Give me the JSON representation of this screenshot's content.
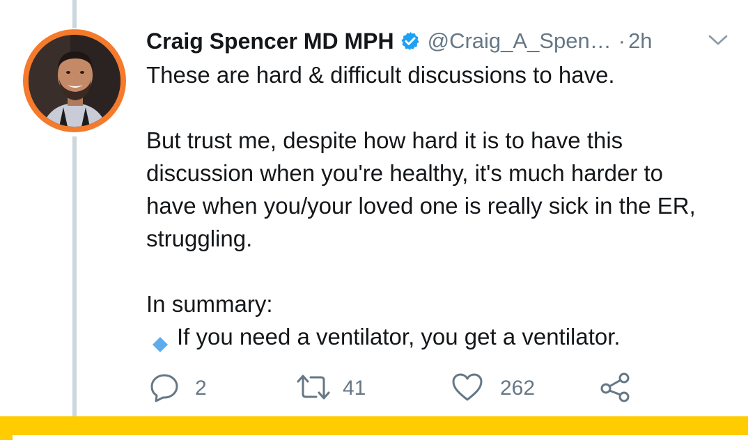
{
  "tweet": {
    "display_name": "Craig Spencer MD MPH",
    "handle": "@Craig_A_Spen…",
    "separator": "·",
    "time": "2h",
    "lines": [
      "These are hard & difficult discussions to have.",
      "But trust me, despite how hard it is to have this",
      "discussion when you're healthy, it's much harder to",
      "have when you/your loved one is really sick in the ER,",
      "struggling.",
      "In summary:",
      "If you need a ventilator, you get a ventilator."
    ],
    "reply_count": "2",
    "retweet_count": "41",
    "like_count": "262"
  },
  "colors": {
    "verified_blue": "#1da1f2",
    "avatar_ring": "#f47a2c",
    "meta_gray": "#657786",
    "thread_line": "#ccd6dd",
    "bottom_bar": "#ffcc00"
  },
  "icons": [
    "verified-badge-icon",
    "chevron-down-icon",
    "blue-diamond-icon",
    "reply-icon",
    "retweet-icon",
    "like-icon",
    "share-icon"
  ]
}
